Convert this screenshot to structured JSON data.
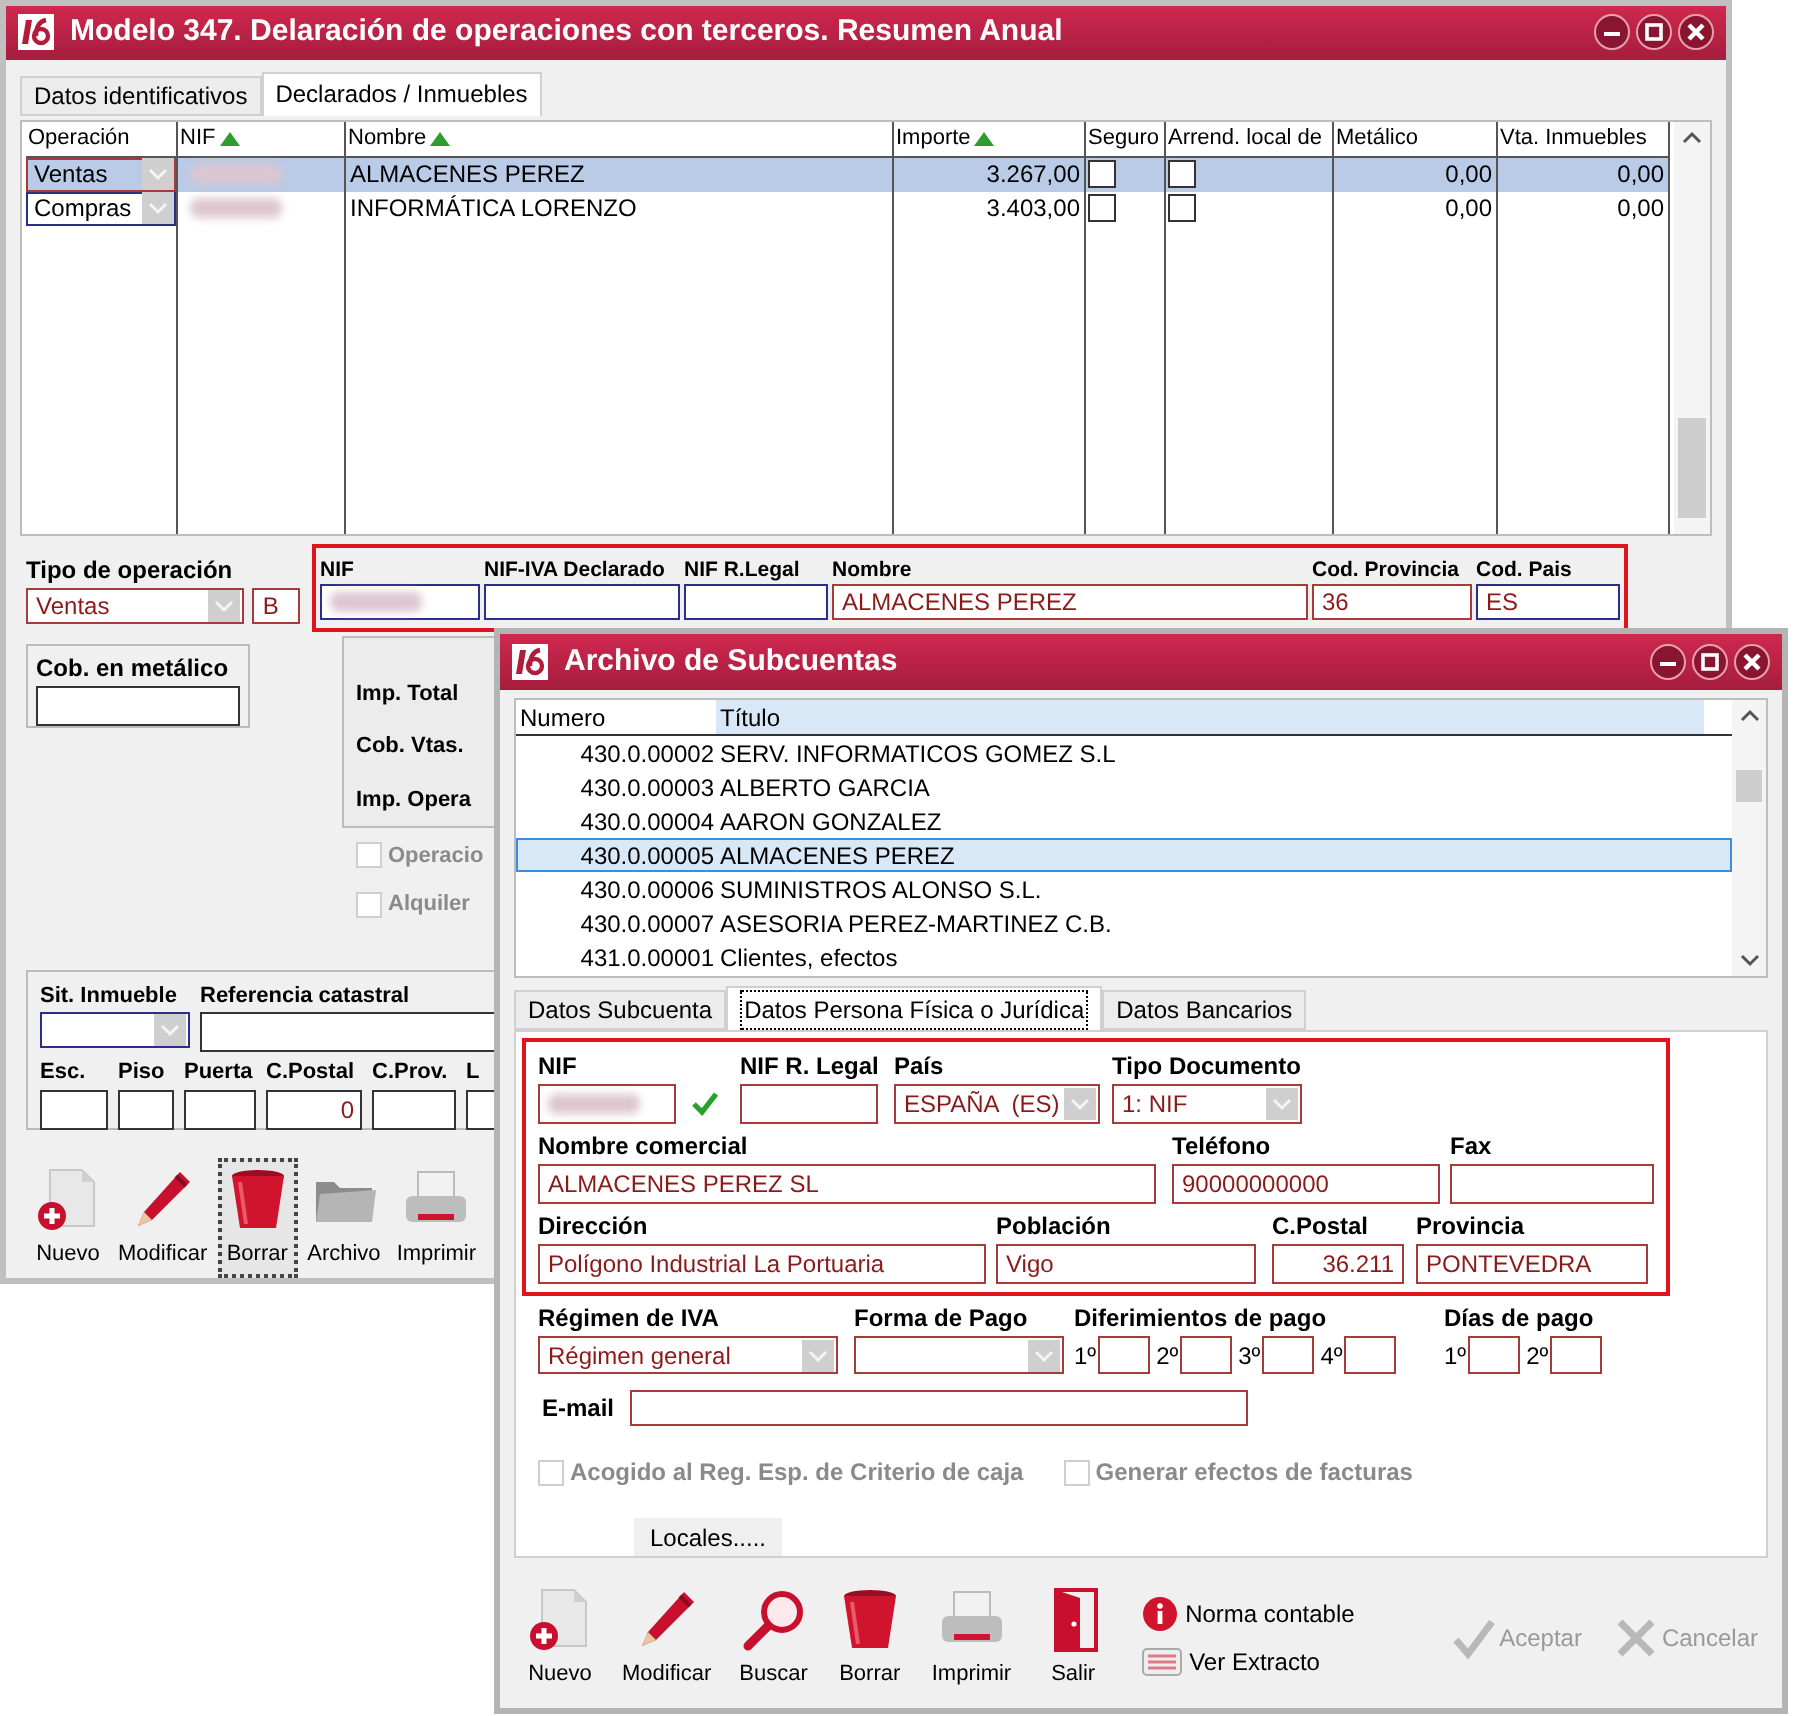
{
  "main_window": {
    "title": "Modelo 347. Delaración de operaciones con terceros. Resumen Anual",
    "tabs": [
      {
        "label": "Datos identificativos",
        "selected": false
      },
      {
        "label": "Declarados / Inmuebles",
        "selected": true
      }
    ],
    "table": {
      "columns": [
        {
          "label": "Operación",
          "sorted": false
        },
        {
          "label": "NIF",
          "sorted": true
        },
        {
          "label": "Nombre",
          "sorted": true
        },
        {
          "label": "Importe",
          "sorted": true
        },
        {
          "label": "Seguro",
          "sorted": false
        },
        {
          "label": "Arrend. local de",
          "sorted": false
        },
        {
          "label": "Metálico",
          "sorted": false
        },
        {
          "label": "Vta. Inmuebles",
          "sorted": false
        }
      ],
      "rows": [
        {
          "selected": true,
          "operacion": "Ventas",
          "nombre": "ALMACENES PEREZ",
          "importe": "3.267,00",
          "seguro": false,
          "arrend": false,
          "metalico": "0,00",
          "vta_inmuebles": "0,00"
        },
        {
          "selected": false,
          "operacion": "Compras",
          "nombre": "INFORMÁTICA LORENZO",
          "importe": "3.403,00",
          "seguro": false,
          "arrend": false,
          "metalico": "0,00",
          "vta_inmuebles": "0,00"
        }
      ]
    },
    "tipo_operacion": {
      "label": "Tipo de operación",
      "value": "Ventas",
      "code": "B"
    },
    "declarado_fields": [
      {
        "label": "NIF",
        "kind": "redacted"
      },
      {
        "label": "NIF-IVA Declarado",
        "kind": "text"
      },
      {
        "label": "NIF R.Legal",
        "kind": "text"
      },
      {
        "label": "Nombre",
        "kind": "text",
        "value": "ALMACENES PEREZ"
      },
      {
        "label": "Cod. Provincia",
        "kind": "text",
        "value": "36"
      },
      {
        "label": "Cod. Pais",
        "kind": "text",
        "value": "ES"
      }
    ],
    "cobro_metalico": {
      "label": "Cob. en metálico"
    },
    "importes_labels": [
      "Imp. Total",
      "Cob. Vtas.",
      "Imp. Opera"
    ],
    "options": [
      {
        "label": "Operacio",
        "checked": false,
        "disabled": true
      },
      {
        "label": "Alquiler",
        "checked": false,
        "disabled": true
      }
    ],
    "inmueble": {
      "sit_label": "Sit. Inmueble",
      "ref_label": "Referencia catastral",
      "fields": [
        {
          "label": "Esc."
        },
        {
          "label": "Piso"
        },
        {
          "label": "Puerta"
        },
        {
          "label": "C.Postal",
          "value": "0"
        },
        {
          "label": "C.Prov."
        },
        {
          "label": "L"
        }
      ]
    },
    "toolbar": [
      {
        "label": "Nuevo",
        "kind": "new",
        "focused": false
      },
      {
        "label": "Modificar",
        "kind": "edit",
        "focused": false
      },
      {
        "label": "Borrar",
        "kind": "delete",
        "focused": true
      },
      {
        "label": "Archivo",
        "kind": "folder",
        "focused": false
      },
      {
        "label": "Imprimir",
        "kind": "print",
        "focused": false
      }
    ]
  },
  "sub_window": {
    "title": "Archivo de Subcuentas",
    "list": {
      "columns": [
        "Numero",
        "Título"
      ],
      "rows": [
        {
          "numero": "430.0.00002",
          "titulo": "SERV. INFORMATICOS GOMEZ S.L",
          "selected": false
        },
        {
          "numero": "430.0.00003",
          "titulo": "ALBERTO GARCIA",
          "selected": false
        },
        {
          "numero": "430.0.00004",
          "titulo": "AARON GONZALEZ",
          "selected": false
        },
        {
          "numero": "430.0.00005",
          "titulo": "ALMACENES PEREZ",
          "selected": true
        },
        {
          "numero": "430.0.00006",
          "titulo": "SUMINISTROS ALONSO S.L.",
          "selected": false
        },
        {
          "numero": "430.0.00007",
          "titulo": "ASESORIA PEREZ-MARTINEZ C.B.",
          "selected": false
        },
        {
          "numero": "431.0.00001",
          "titulo": "Clientes, efectos",
          "selected": false
        }
      ]
    },
    "tabs": [
      {
        "label": "Datos Subcuenta",
        "selected": false
      },
      {
        "label": "Datos Persona Física o Jurídica",
        "selected": true
      },
      {
        "label": "Datos Bancarios",
        "selected": false
      }
    ],
    "persona_fields": [
      [
        {
          "label": "NIF",
          "kind": "redacted",
          "verified": true
        },
        {
          "label": "NIF R. Legal",
          "kind": "text"
        },
        {
          "label": "País",
          "kind": "select",
          "value": "ESPAÑA  (ES)"
        },
        {
          "label": "Tipo Documento",
          "kind": "select",
          "value": "1: NIF"
        }
      ],
      [
        {
          "label": "Nombre comercial",
          "kind": "text",
          "value": "ALMACENES PEREZ SL"
        },
        {
          "label": "Teléfono",
          "kind": "text",
          "value": "90000000000"
        },
        {
          "label": "Fax",
          "kind": "text"
        }
      ],
      [
        {
          "label": "Dirección",
          "kind": "text",
          "value": "Polígono Industrial La Portuaria"
        },
        {
          "label": "Población",
          "kind": "text",
          "value": "Vigo"
        },
        {
          "label": "C.Postal",
          "kind": "number",
          "value": "36.211"
        },
        {
          "label": "Provincia",
          "kind": "text",
          "value": "PONTEVEDRA"
        }
      ]
    ],
    "regimen": {
      "label": "Régimen de IVA",
      "value": "Régimen general"
    },
    "forma_pago": {
      "label": "Forma de Pago"
    },
    "diferimientos": {
      "label": "Diferimientos de pago",
      "slots": [
        "1º",
        "2º",
        "3º",
        "4º"
      ]
    },
    "dias_pago": {
      "label": "Días de pago",
      "slots": [
        "1º",
        "2º"
      ]
    },
    "email": {
      "label": "E-mail"
    },
    "options": [
      {
        "label": "Acogido al Reg. Esp. de Criterio de caja",
        "checked": false,
        "disabled": true
      },
      {
        "label": "Generar efectos de facturas",
        "checked": false,
        "disabled": true
      }
    ],
    "locales_button": "Locales.....",
    "toolbar": [
      {
        "label": "Nuevo",
        "kind": "new",
        "focused": false
      },
      {
        "label": "Modificar",
        "kind": "edit",
        "focused": false
      },
      {
        "label": "Buscar",
        "kind": "search",
        "focused": false
      },
      {
        "label": "Borrar",
        "kind": "delete",
        "focused": false
      },
      {
        "label": "Imprimir",
        "kind": "print",
        "focused": false
      },
      {
        "label": "Salir",
        "kind": "exit",
        "focused": false
      }
    ],
    "links": [
      {
        "label": "Norma contable",
        "kind": "info"
      },
      {
        "label": "Ver Extracto",
        "kind": "keyboard"
      }
    ],
    "actions": [
      {
        "label": "Aceptar",
        "kind": "accept",
        "disabled": true
      },
      {
        "label": "Cancelar",
        "kind": "cancel",
        "disabled": true
      }
    ]
  }
}
